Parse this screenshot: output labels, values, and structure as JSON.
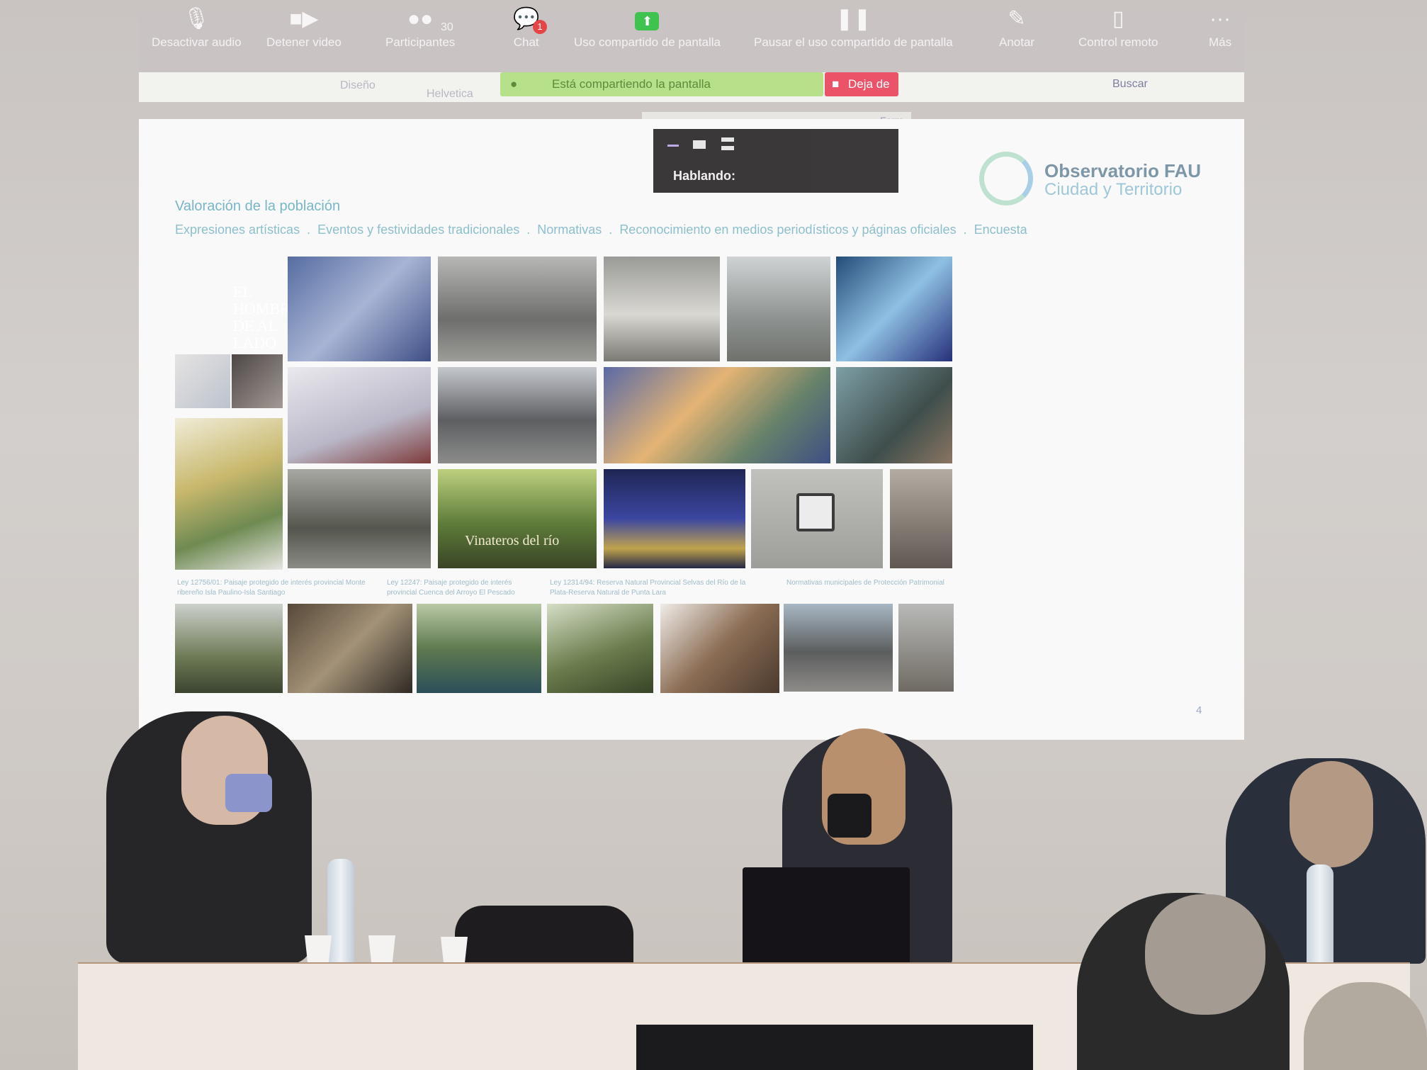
{
  "zoom_toolbar": {
    "items": [
      {
        "label": "Desactivar audio",
        "icon": "microphone-icon"
      },
      {
        "label": "Detener video",
        "icon": "camera-icon"
      },
      {
        "label": "Participantes",
        "icon": "participants-icon",
        "count": "30"
      },
      {
        "label": "Chat",
        "icon": "chat-icon",
        "badge": "1"
      },
      {
        "label": "Uso compartido de pantalla",
        "icon": "share-screen-icon"
      },
      {
        "label": "Pausar el uso compartido de pantalla",
        "icon": "pause-icon"
      },
      {
        "label": "Anotar",
        "icon": "pencil-icon"
      },
      {
        "label": "Control remoto",
        "icon": "mouse-icon"
      },
      {
        "label": "Más",
        "icon": "more-icon"
      }
    ],
    "sharing_status": "Está compartiendo la pantalla",
    "stop_sharing": "Deja de"
  },
  "ribbon": {
    "design": "Diseño",
    "font": "Helvetica",
    "search": "Buscar",
    "form": "Form"
  },
  "talking_panel": {
    "label": "Hablando:"
  },
  "slide": {
    "logo_line1": "Observatorio FAU",
    "logo_line2": "Ciudad y Territorio",
    "title": "Valoración de la población",
    "subtitle_items": [
      "Expresiones artísticas",
      "Eventos y festividades tradicionales",
      "Normativas",
      "Reconocimiento en medios periodísticos y páginas oficiales",
      "Encuesta"
    ],
    "poster_text": "EL HOMBRE DE AL LADO",
    "film_text": "Vinateros del río",
    "captions": [
      "Ley 12756/01: Paisaje protegido de interés provincial Monte ribereño Isla Paulino-Isla Santiago",
      "Ley 12247: Paisaje protegido de interés provincial Cuenca del Arroyo El Pescado",
      "Ley 12314/94: Reserva Natural Provincial Selvas del Río de la Plata-Reserva Natural de Punta Lara",
      "Normativas municipales de Protección Patrimonial"
    ],
    "page_number": "4"
  },
  "colors": {
    "slide_title": "#78b6c6",
    "zoom_green": "#3fc34f",
    "stop_red": "#ea5368"
  }
}
